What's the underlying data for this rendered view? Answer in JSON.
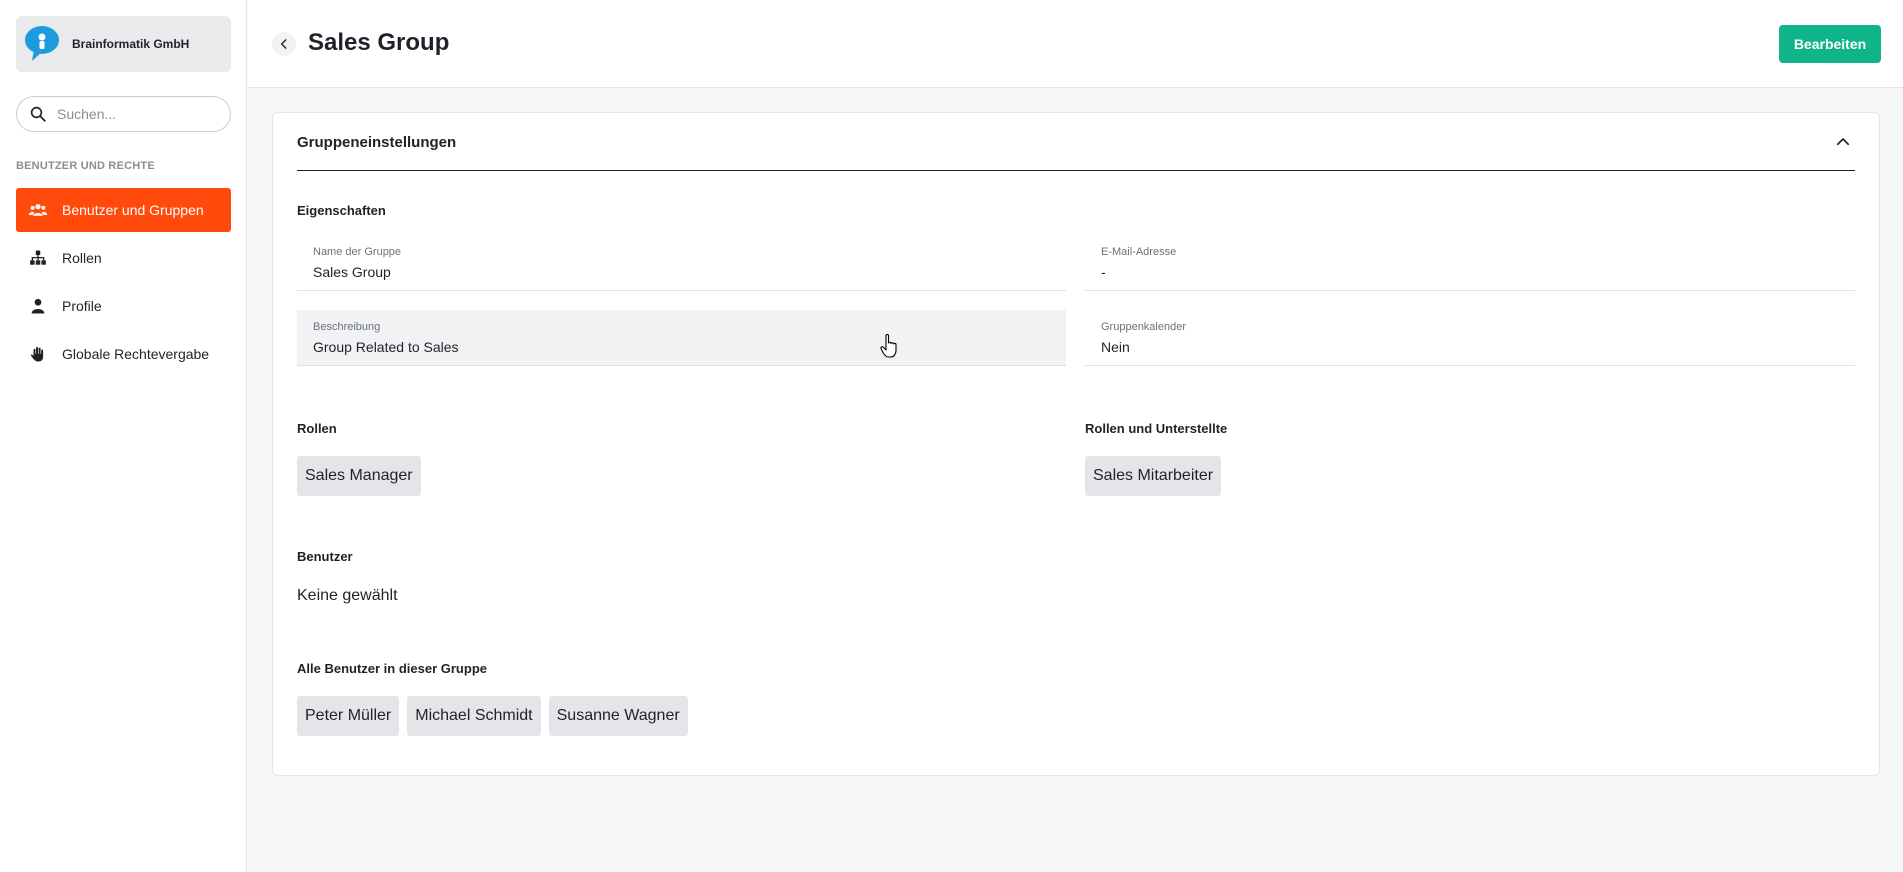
{
  "org": {
    "name": "Brainformatik GmbH"
  },
  "search": {
    "placeholder": "Suchen..."
  },
  "sidebar": {
    "section_label": "BENUTZER UND RECHTE",
    "items": [
      {
        "label": "Benutzer und Gruppen",
        "icon": "users-icon",
        "active": true
      },
      {
        "label": "Rollen",
        "icon": "hierarchy-icon",
        "active": false
      },
      {
        "label": "Profile",
        "icon": "person-icon",
        "active": false
      },
      {
        "label": "Globale Rechtevergabe",
        "icon": "hand-icon",
        "active": false
      }
    ]
  },
  "header": {
    "title": "Sales Group",
    "edit_label": "Bearbeiten"
  },
  "card": {
    "title": "Gruppeneinstellungen",
    "properties_heading": "Eigenschaften",
    "fields": {
      "group_name": {
        "label": "Name der Gruppe",
        "value": "Sales Group"
      },
      "email": {
        "label": "E-Mail-Adresse",
        "value": "-"
      },
      "description": {
        "label": "Beschreibung",
        "value": "Group Related to Sales"
      },
      "calendar": {
        "label": "Gruppenkalender",
        "value": "Nein"
      }
    },
    "roles": {
      "heading": "Rollen",
      "chips": [
        "Sales Manager"
      ]
    },
    "roles_sub": {
      "heading": "Rollen und Unterstellte",
      "chips": [
        "Sales Mitarbeiter"
      ]
    },
    "users": {
      "heading": "Benutzer",
      "empty_text": "Keine gewählt"
    },
    "all_users": {
      "heading": "Alle Benutzer in dieser Gruppe",
      "chips": [
        "Peter Müller",
        "Michael Schmidt",
        "Susanne Wagner"
      ]
    }
  },
  "colors": {
    "accent": "#ff4a0c",
    "primary_button": "#0fb48b",
    "logo": "#1e9be0"
  }
}
